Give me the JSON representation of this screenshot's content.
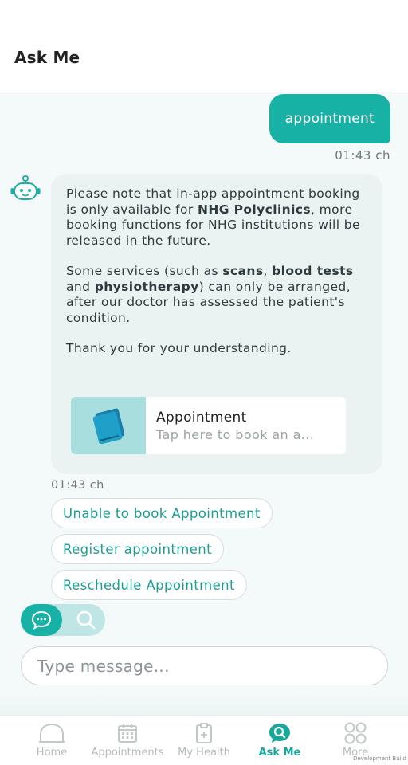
{
  "header": {
    "title": "Ask Me"
  },
  "user_message": {
    "text": "appointment",
    "time": "01:43 ch"
  },
  "bot_message": {
    "para1": {
      "t1": "Please note that in-app appointment booking is only available for ",
      "b1": "NHG Polyclinics",
      "t2": ", more booking functions for NHG institutions will be released in the future."
    },
    "para2": {
      "t1": "Some services (such as ",
      "b1": "scans",
      "t2": ", ",
      "b2": "blood tests",
      "t3": " and ",
      "b3": "physiotherapy",
      "t4": ") can only be arranged, after our doctor has assessed the patient's condition."
    },
    "para3": "Thank you for your understanding.",
    "card": {
      "title": "Appointment",
      "subtitle": "Tap here to book an a..."
    },
    "time": "01:43 ch"
  },
  "quick_replies": [
    "Unable to book Appointment",
    "Register appointment",
    "Reschedule Appointment"
  ],
  "input": {
    "placeholder": "Type message..."
  },
  "tabs": [
    {
      "label": "Home",
      "icon": "home-icon",
      "active": false
    },
    {
      "label": "Appointments",
      "icon": "calendar-icon",
      "active": false
    },
    {
      "label": "My Health",
      "icon": "clipboard-icon",
      "active": false
    },
    {
      "label": "Ask Me",
      "icon": "chat-search-icon",
      "active": true
    },
    {
      "label": "More",
      "icon": "grid-icon",
      "active": false
    }
  ],
  "watermark": "Development Build",
  "colors": {
    "accent": "#17b1a5",
    "accent_light": "#bfe6e4",
    "card_icon_bg": "#a8dede",
    "bubble_bg": "#eaf2f2"
  }
}
